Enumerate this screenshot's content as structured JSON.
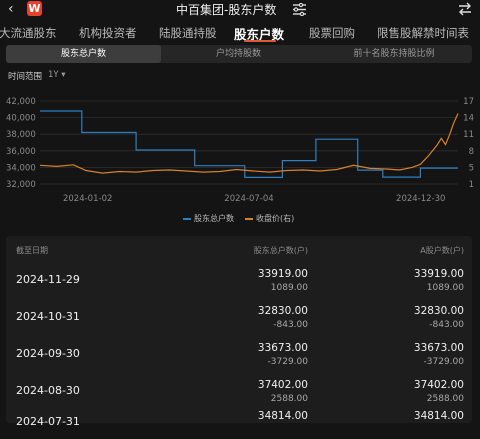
{
  "header": {
    "back_glyph": "‹",
    "logo_text": "W",
    "title": "中百集团-股东户数"
  },
  "tabs": [
    "大流通股东",
    "机构投资者",
    "陆股通持股",
    "股东户数",
    "股票回购",
    "限售股解禁时间表"
  ],
  "segments": [
    "股东总户数",
    "户均持股数",
    "前十名股东持股比例"
  ],
  "time_range": {
    "label": "时间范围",
    "value": "1Y ▾"
  },
  "legend": {
    "series1": "股东总户数",
    "series2": "收盘价(右)"
  },
  "colors": {
    "series1": "#2f7fc1",
    "series2": "#d9822b",
    "accent": "#e05a3a"
  },
  "table": {
    "headers": {
      "date": "截至日期",
      "total": "股东总户数(户)",
      "a_share": "A股户数(户)"
    },
    "rows": [
      {
        "date": "2024-11-29",
        "total": "33919.00",
        "total_chg": "1089.00",
        "a": "33919.00",
        "a_chg": "1089.00"
      },
      {
        "date": "2024-10-31",
        "total": "32830.00",
        "total_chg": "-843.00",
        "a": "32830.00",
        "a_chg": "-843.00"
      },
      {
        "date": "2024-09-30",
        "total": "33673.00",
        "total_chg": "-3729.00",
        "a": "33673.00",
        "a_chg": "-3729.00"
      },
      {
        "date": "2024-08-30",
        "total": "37402.00",
        "total_chg": "2588.00",
        "a": "37402.00",
        "a_chg": "2588.00"
      },
      {
        "date": "2024-07-31",
        "total": "34814.00",
        "total_chg": "",
        "a": "34814.00",
        "a_chg": ""
      }
    ]
  },
  "chart_data": {
    "type": "line",
    "x_ticks": [
      "2024-01-02",
      "2024-07-04",
      "2024-12-30"
    ],
    "y_left_ticks": [
      32000,
      34000,
      36000,
      38000,
      40000,
      42000
    ],
    "y_right_ticks": [
      1,
      5,
      8,
      11,
      14,
      17
    ],
    "ylim_left": [
      32000,
      42000
    ],
    "ylim_right": [
      1,
      17
    ],
    "series": [
      {
        "name": "股东总户数",
        "axis": "left",
        "x": [
          0,
          0.1,
          0.1,
          0.23,
          0.23,
          0.37,
          0.37,
          0.49,
          0.49,
          0.58,
          0.58,
          0.66,
          0.66,
          0.76,
          0.76,
          0.82,
          0.82,
          0.91,
          0.91,
          1.0
        ],
        "values": [
          40800,
          40800,
          38200,
          38200,
          36100,
          36100,
          34200,
          34200,
          32800,
          32800,
          34814,
          34814,
          37402,
          37402,
          33673,
          33673,
          32830,
          32830,
          33919,
          33919
        ]
      },
      {
        "name": "收盘价(右)",
        "axis": "right",
        "x": [
          0,
          0.04,
          0.08,
          0.11,
          0.15,
          0.19,
          0.23,
          0.27,
          0.31,
          0.35,
          0.39,
          0.43,
          0.47,
          0.51,
          0.55,
          0.59,
          0.63,
          0.67,
          0.71,
          0.75,
          0.79,
          0.83,
          0.86,
          0.89,
          0.91,
          0.93,
          0.95,
          0.96,
          0.97,
          0.98,
          0.99,
          1.0
        ],
        "values": [
          4.6,
          4.4,
          4.7,
          3.6,
          3.1,
          3.4,
          3.3,
          3.6,
          3.7,
          3.5,
          3.3,
          3.4,
          3.8,
          3.5,
          3.3,
          3.6,
          3.7,
          3.5,
          3.8,
          4.6,
          4.0,
          3.9,
          3.7,
          4.2,
          4.8,
          6.5,
          8.5,
          9.8,
          8.6,
          10.5,
          12.8,
          14.6
        ]
      }
    ]
  }
}
